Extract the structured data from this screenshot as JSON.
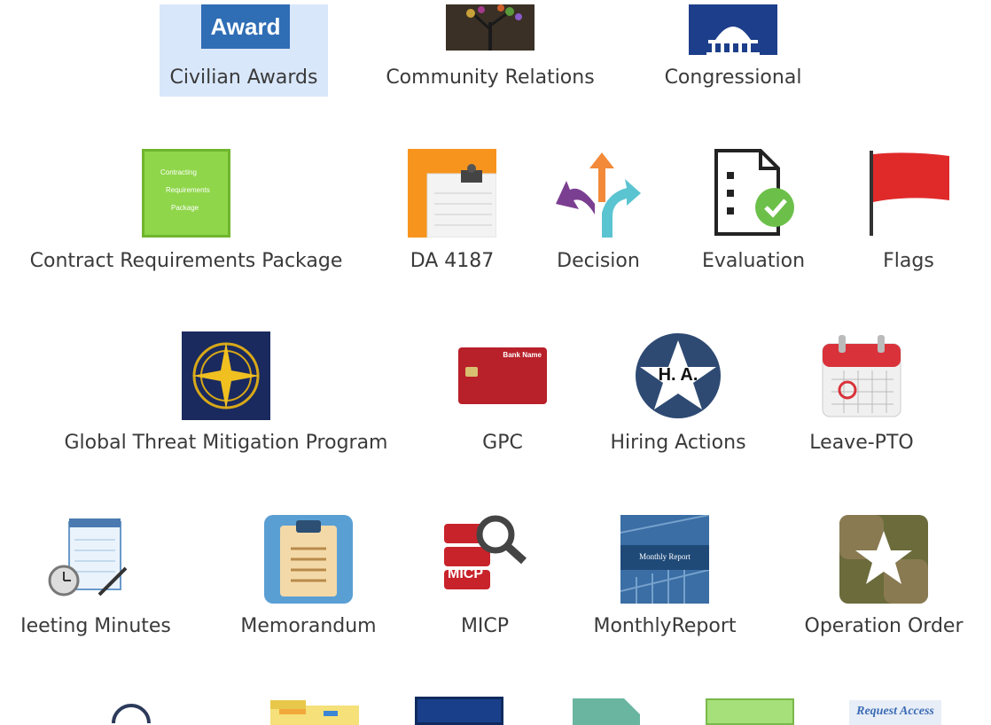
{
  "apps": [
    {
      "label": "Civilian Awards",
      "icon": "award-icon",
      "icon_text": "Award",
      "selected": true
    },
    {
      "label": "Community Relations",
      "icon": "community-tree-icon"
    },
    {
      "label": "Congressional",
      "icon": "capitol-icon"
    },
    {
      "label": "Contract Requirements Package",
      "icon": "crp-icon",
      "icon_lines": [
        "Contracting",
        "Requirements",
        "Package"
      ]
    },
    {
      "label": "DA 4187",
      "icon": "da4187-clipboard-icon"
    },
    {
      "label": "Decision",
      "icon": "decision-arrows-icon"
    },
    {
      "label": "Evaluation",
      "icon": "evaluation-checklist-icon"
    },
    {
      "label": "Flags",
      "icon": "flag-icon"
    },
    {
      "label": "Global Threat Mitigation Program",
      "icon": "compass-emblem-icon"
    },
    {
      "label": "GPC",
      "icon": "credit-card-icon",
      "icon_text": "Bank Name"
    },
    {
      "label": "Hiring Actions",
      "icon": "star-badge-icon",
      "icon_text": "H. A."
    },
    {
      "label": "Leave-PTO",
      "icon": "calendar-icon"
    },
    {
      "label": "Ieeting Minutes",
      "icon": "notepad-clock-icon"
    },
    {
      "label": "Memorandum",
      "icon": "clipboard-icon"
    },
    {
      "label": "MICP",
      "icon": "micp-search-icon",
      "icon_text": "MICP"
    },
    {
      "label": "MonthlyReport",
      "icon": "monthly-report-icon",
      "icon_text": "Monthly Report"
    },
    {
      "label": "Operation Order",
      "icon": "star-square-icon"
    },
    {
      "label": "",
      "icon": "loading-spinner-icon"
    },
    {
      "label": "",
      "icon": "folder-icon"
    },
    {
      "label": "",
      "icon": "blue-box-icon"
    },
    {
      "label": "",
      "icon": "document-icon"
    },
    {
      "label": "",
      "icon": "green-box-icon"
    },
    {
      "label": "",
      "icon": "request-access-icon",
      "icon_text": "Request Access"
    }
  ],
  "colors": {
    "selected": "#d9e7fb",
    "award": "#2f6db5",
    "crp": "#8fd64a",
    "da4187": "#f7941d",
    "flag": "#e02a2a",
    "gtmp": "#1a2a5e",
    "hiring": "#2e4a73",
    "calendar": "#d9323a",
    "operation": "#6b6b3b"
  }
}
